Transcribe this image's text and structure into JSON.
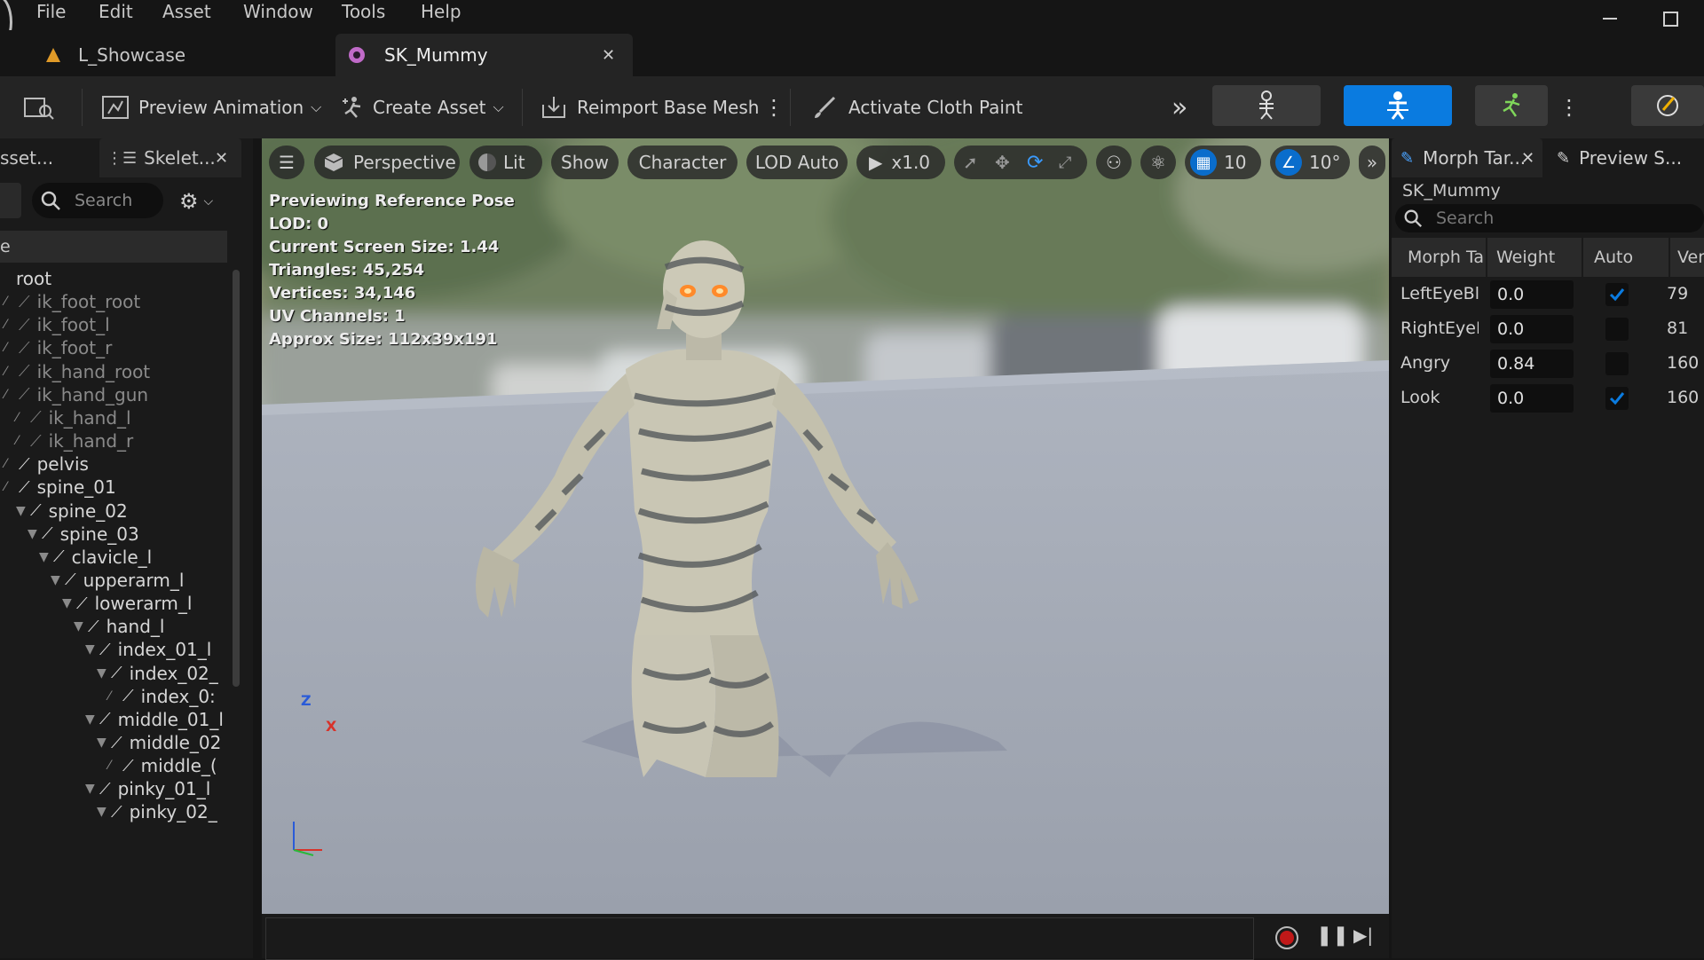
{
  "menu": {
    "items": [
      "File",
      "Edit",
      "Asset",
      "Window",
      "Tools",
      "Help"
    ]
  },
  "tabs": [
    {
      "label": "L_Showcase",
      "active": false
    },
    {
      "label": "SK_Mummy",
      "active": true
    }
  ],
  "toolbar": {
    "preview_animation": "Preview Animation",
    "create_asset": "Create Asset",
    "reimport": "Reimport Base Mesh",
    "cloth_paint": "Activate Cloth Paint"
  },
  "left_panel": {
    "tab_asset": "sset...",
    "tab_skeleton": "Skelet...",
    "search_placeholder": "Search",
    "header_label": "e",
    "tree": [
      {
        "label": "root",
        "virtual": false
      },
      {
        "label": "ik_foot_root",
        "virtual": true
      },
      {
        "label": "ik_foot_l",
        "virtual": true
      },
      {
        "label": "ik_foot_r",
        "virtual": true
      },
      {
        "label": "ik_hand_root",
        "virtual": true
      },
      {
        "label": "ik_hand_gun",
        "virtual": true
      },
      {
        "label": "ik_hand_l",
        "virtual": true
      },
      {
        "label": "ik_hand_r",
        "virtual": true
      },
      {
        "label": "pelvis",
        "virtual": false
      },
      {
        "label": "spine_01",
        "virtual": false
      },
      {
        "label": "spine_02",
        "virtual": false
      },
      {
        "label": "spine_03",
        "virtual": false
      },
      {
        "label": "clavicle_l",
        "virtual": false
      },
      {
        "label": "upperarm_l",
        "virtual": false
      },
      {
        "label": "lowerarm_l",
        "virtual": false
      },
      {
        "label": "hand_l",
        "virtual": false
      },
      {
        "label": "index_01_l",
        "virtual": false
      },
      {
        "label": "index_02_",
        "virtual": false
      },
      {
        "label": "index_0:",
        "virtual": false
      },
      {
        "label": "middle_01_l",
        "virtual": false
      },
      {
        "label": "middle_02",
        "virtual": false
      },
      {
        "label": "middle_(",
        "virtual": false
      },
      {
        "label": "pinky_01_l",
        "virtual": false
      },
      {
        "label": "pinky_02_",
        "virtual": false
      }
    ]
  },
  "viewport": {
    "perspective": "Perspective",
    "lit": "Lit",
    "show": "Show",
    "character": "Character",
    "lod": "LOD Auto",
    "speed": "x1.0",
    "grid_value": "10",
    "angle_value": "10°",
    "info": [
      "Previewing Reference Pose",
      "LOD: 0",
      "Current Screen Size: 1.44",
      "Triangles: 45,254",
      "Vertices: 34,146",
      "UV Channels: 1",
      "Approx Size: 112x39x191"
    ],
    "axis_z": "Z",
    "axis_x": "X"
  },
  "right_panel": {
    "tab_morph": "Morph Tar...",
    "tab_preview": "Preview S...",
    "asset_name": "SK_Mummy",
    "search_placeholder": "Search",
    "columns": [
      "Morph Ta",
      "Weight",
      "Auto",
      "Vert"
    ],
    "rows": [
      {
        "name": "LeftEyeBlir",
        "weight": "0.0",
        "auto": true,
        "verts": "79"
      },
      {
        "name": "RightEyeBl",
        "weight": "0.0",
        "auto": false,
        "verts": "81"
      },
      {
        "name": "Angry",
        "weight": "0.84",
        "auto": false,
        "verts": "160"
      },
      {
        "name": "Look",
        "weight": "0.0",
        "auto": true,
        "verts": "160"
      }
    ]
  },
  "colors": {
    "accent": "#0a7be0",
    "panel": "#1a1a1a",
    "toolbar": "#242424"
  }
}
